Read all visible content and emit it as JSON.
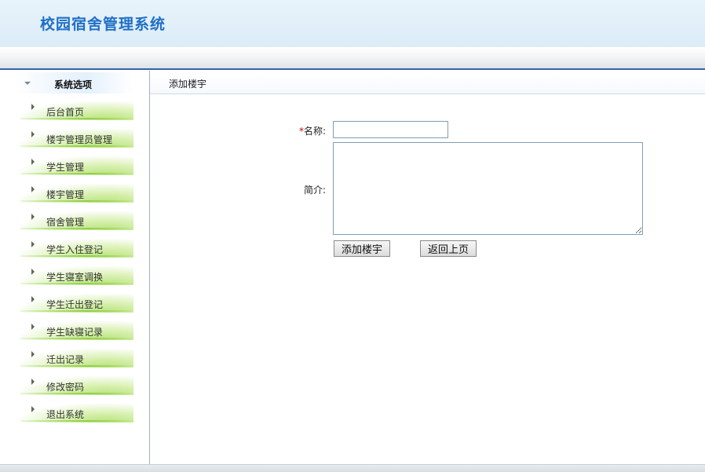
{
  "app": {
    "title": "校园宿舍管理系统"
  },
  "sidebar": {
    "header": "系统选项",
    "items": [
      {
        "label": "后台首页"
      },
      {
        "label": "楼宇管理员管理"
      },
      {
        "label": "学生管理"
      },
      {
        "label": "楼宇管理"
      },
      {
        "label": "宿舍管理"
      },
      {
        "label": "学生入住登记"
      },
      {
        "label": "学生寝室调换"
      },
      {
        "label": "学生迁出登记"
      },
      {
        "label": "学生缺寝记录"
      },
      {
        "label": "迁出记录"
      },
      {
        "label": "修改密码"
      },
      {
        "label": "退出系统"
      }
    ]
  },
  "main": {
    "breadcrumb": "添加楼宇",
    "form": {
      "required_mark": "*",
      "name_label": "名称:",
      "name_value": "",
      "intro_label": "简介:",
      "intro_value": "",
      "submit_label": "添加楼宇",
      "back_label": "返回上页"
    }
  },
  "colors": {
    "title": "#1f6fc6",
    "accent_border": "#2f64a7",
    "menu_green": "#8fd14a",
    "required": "#d10000"
  }
}
